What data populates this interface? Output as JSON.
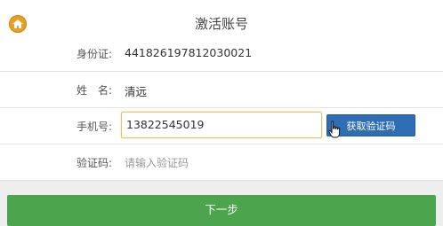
{
  "header": {
    "title": "激活账号",
    "home_icon": "home-icon"
  },
  "form": {
    "id_card": {
      "label": "身份证:",
      "value": "441826197812030021"
    },
    "name": {
      "label": "姓　名:",
      "value": "清远"
    },
    "phone": {
      "label": "手机号:",
      "value": "13822545019",
      "button": "获取验证码"
    },
    "code": {
      "label": "验证码:",
      "placeholder": "请输入验证码"
    }
  },
  "actions": {
    "next": "下一步"
  },
  "colors": {
    "primary": "#2f6db5",
    "next": "#4ca44c",
    "home": "#e4a12a"
  }
}
